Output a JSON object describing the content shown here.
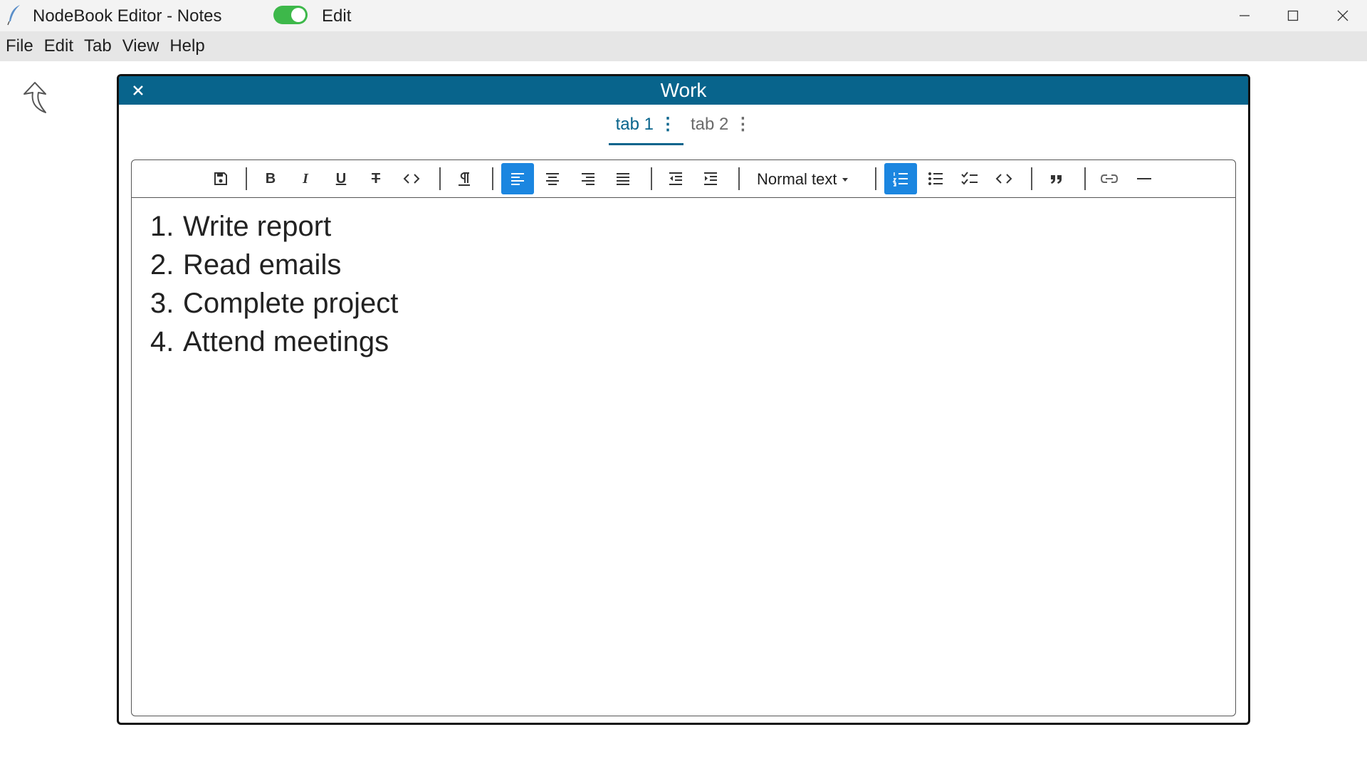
{
  "window": {
    "title": "NodeBook Editor - Notes",
    "toggle_label": "Edit",
    "toggle_on": true,
    "toggle_color": "#3db84a"
  },
  "menu": [
    "File",
    "Edit",
    "Tab",
    "View",
    "Help"
  ],
  "panel": {
    "title": "Work",
    "header_color": "#08648c",
    "close_icon": "close-icon",
    "tabs": [
      {
        "label": "tab 1",
        "active": true
      },
      {
        "label": "tab 2",
        "active": false
      }
    ]
  },
  "toolbar": {
    "style_select": "Normal text",
    "active_color": "#1b86e0",
    "active_buttons": [
      "align-left",
      "ordered-list"
    ]
  },
  "document": {
    "items": [
      {
        "num": "1.",
        "text": "Write report"
      },
      {
        "num": "2.",
        "text": "Read emails"
      },
      {
        "num": "3.",
        "text": "Complete project"
      },
      {
        "num": "4.",
        "text": "Attend meetings"
      }
    ]
  }
}
